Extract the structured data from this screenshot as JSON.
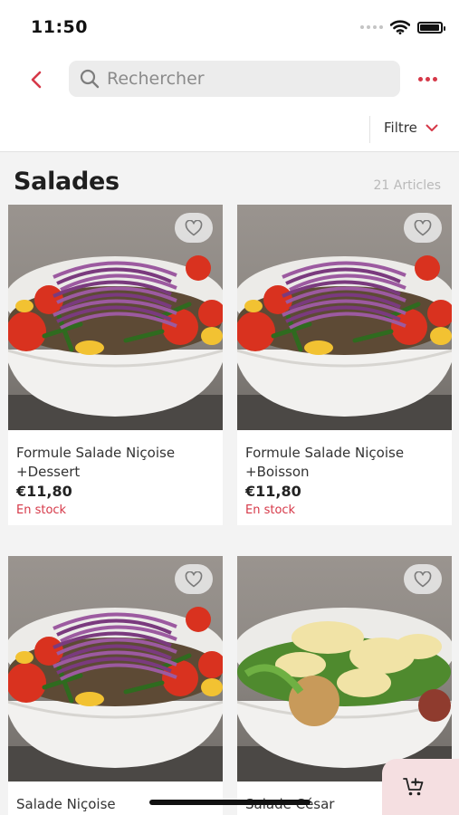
{
  "status_bar": {
    "time": "11:50",
    "battery_level": 0.95
  },
  "header": {
    "search_placeholder": "Rechercher"
  },
  "filter": {
    "label": "Filtre"
  },
  "section": {
    "title": "Salades",
    "count": "21 Articles"
  },
  "products": [
    {
      "name": "Formule Salade Niçoise +Dessert",
      "price": "€11,80",
      "stock": "En stock",
      "image": "nicoise"
    },
    {
      "name": "Formule Salade Niçoise +Boisson",
      "price": "€11,80",
      "stock": "En stock",
      "image": "nicoise"
    },
    {
      "name": "Salade Niçoise",
      "image": "nicoise"
    },
    {
      "name": "Salade César",
      "image": "cesar"
    }
  ],
  "colors": {
    "accent": "#d63848",
    "cart_fab": "#f5dfe1",
    "stock": "#d63848"
  },
  "icons": [
    "back-icon",
    "search-icon",
    "more-icon",
    "chevron-down-icon",
    "heart-icon",
    "cart-icon",
    "wifi-icon",
    "battery-icon"
  ]
}
